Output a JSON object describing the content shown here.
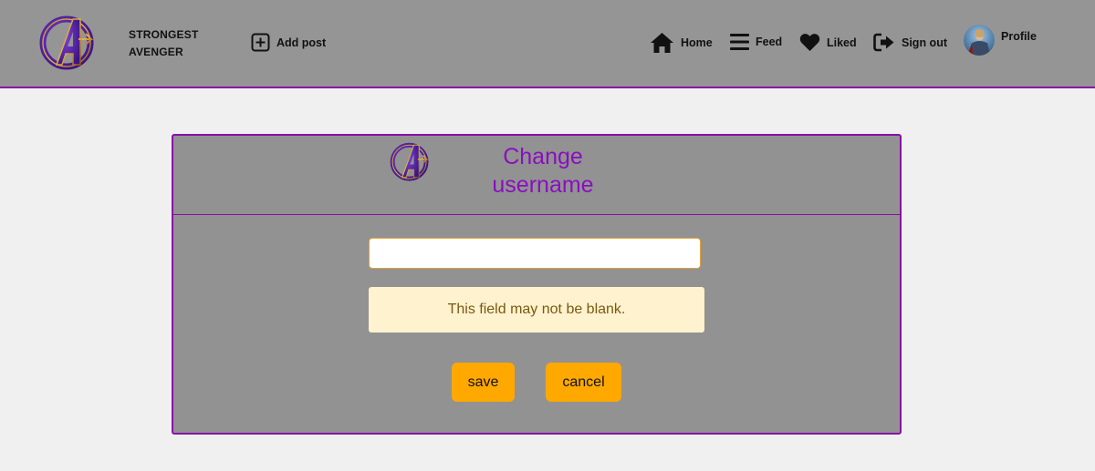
{
  "navbar": {
    "brand_line1": "STRONGEST",
    "brand_line2": "AVENGER",
    "add_post": "Add post",
    "home": "Home",
    "feed": "Feed",
    "liked": "Liked",
    "sign_out": "Sign out",
    "profile": "Profile"
  },
  "form": {
    "title_line1": "Change",
    "title_line2": "username",
    "input_value": "",
    "error_message": "This field may not be blank.",
    "save_label": "save",
    "cancel_label": "cancel"
  },
  "colors": {
    "accent_purple": "#8a0fa8",
    "button_orange": "#ffa800",
    "alert_bg": "#fff2cf",
    "navbar_bg": "#959595"
  },
  "icons": {
    "logo": "avengers-logo-icon",
    "add_post": "plus-square-icon",
    "home": "home-icon",
    "feed": "bars-icon",
    "liked": "heart-icon",
    "sign_out": "sign-out-icon"
  }
}
